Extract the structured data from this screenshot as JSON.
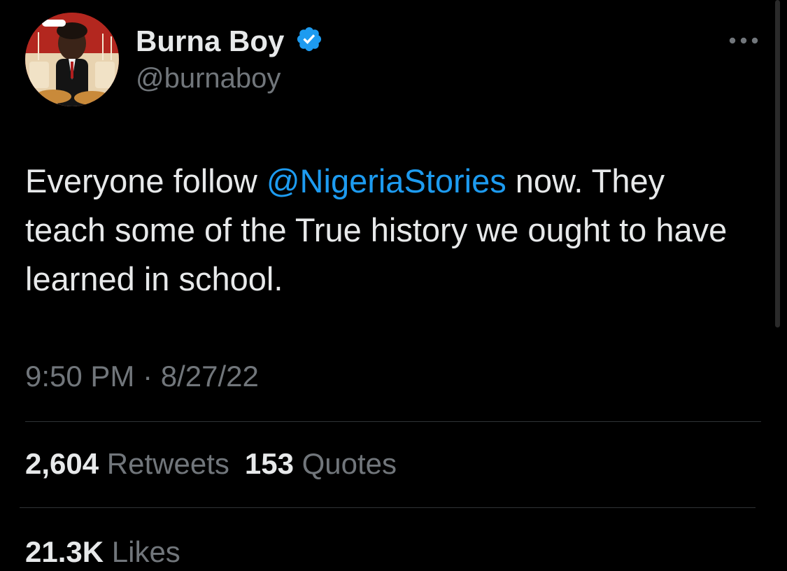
{
  "author": {
    "display_name": "Burna Boy",
    "handle": "@burnaboy",
    "verified": true
  },
  "tweet": {
    "text_before_mention": "Everyone follow ",
    "mention": "@NigeriaStories",
    "text_after_mention": " now. They teach some of the True history we ought to have learned in school.",
    "time": "9:50 PM",
    "separator": " · ",
    "date": "8/27/22"
  },
  "stats": {
    "retweets_count": "2,604",
    "retweets_label": "Retweets",
    "quotes_count": "153",
    "quotes_label": "Quotes",
    "likes_count": "21.3K",
    "likes_label": "Likes"
  },
  "icons": {
    "verified": "verified-badge-icon",
    "more": "more-options-icon"
  },
  "colors": {
    "background": "#000000",
    "text": "#e7e9ea",
    "secondary": "#71767b",
    "accent": "#1d9bf0",
    "divider": "#2f3336"
  }
}
